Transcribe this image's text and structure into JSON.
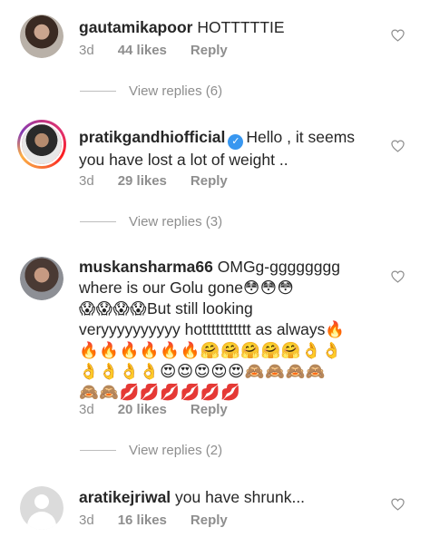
{
  "comments": [
    {
      "username": "gautamikapoor",
      "text": "HOTTTTTIE",
      "time": "3d",
      "likes": "44 likes",
      "reply": "Reply",
      "view_replies": "View replies (6)"
    },
    {
      "username": "pratikgandhiofficial",
      "verified": true,
      "text_line1": "Hello , it seems",
      "text_line2": "you have lost a lot of weight ..",
      "time": "3d",
      "likes": "29 likes",
      "reply": "Reply",
      "view_replies": "View replies (3)"
    },
    {
      "username": "muskansharma66",
      "text_line1": "OMGg-gggggggg",
      "text_line2": "where is our Golu gone",
      "emoji_line2": "😳😳😳",
      "emoji_line3a": "😱😱😱😱",
      "text_line3": "But still looking",
      "text_line4": "veryyyyyyyyyy hottttttttttt as always",
      "emoji_line4": "🔥",
      "emoji_line5": "🔥🔥🔥🔥🔥🔥🤗🤗🤗🤗🤗👌👌",
      "emoji_line6": "👌👌👌👌😍😍😍😍😍🙈🙈🙈🙈",
      "emoji_line7": "🙈🙈💋💋💋💋💋💋",
      "time": "3d",
      "likes": "20 likes",
      "reply": "Reply",
      "view_replies": "View replies (2)"
    },
    {
      "username": "aratikejriwal",
      "text": "you have shrunk...",
      "time": "3d",
      "likes": "16 likes",
      "reply": "Reply"
    }
  ],
  "icons": {
    "like": "heart-outline-icon",
    "verified": "verified-badge-icon",
    "default_avatar": "default-avatar-icon"
  },
  "colors": {
    "text": "#262626",
    "muted": "#8e8e8e",
    "verified": "#3897f0"
  }
}
